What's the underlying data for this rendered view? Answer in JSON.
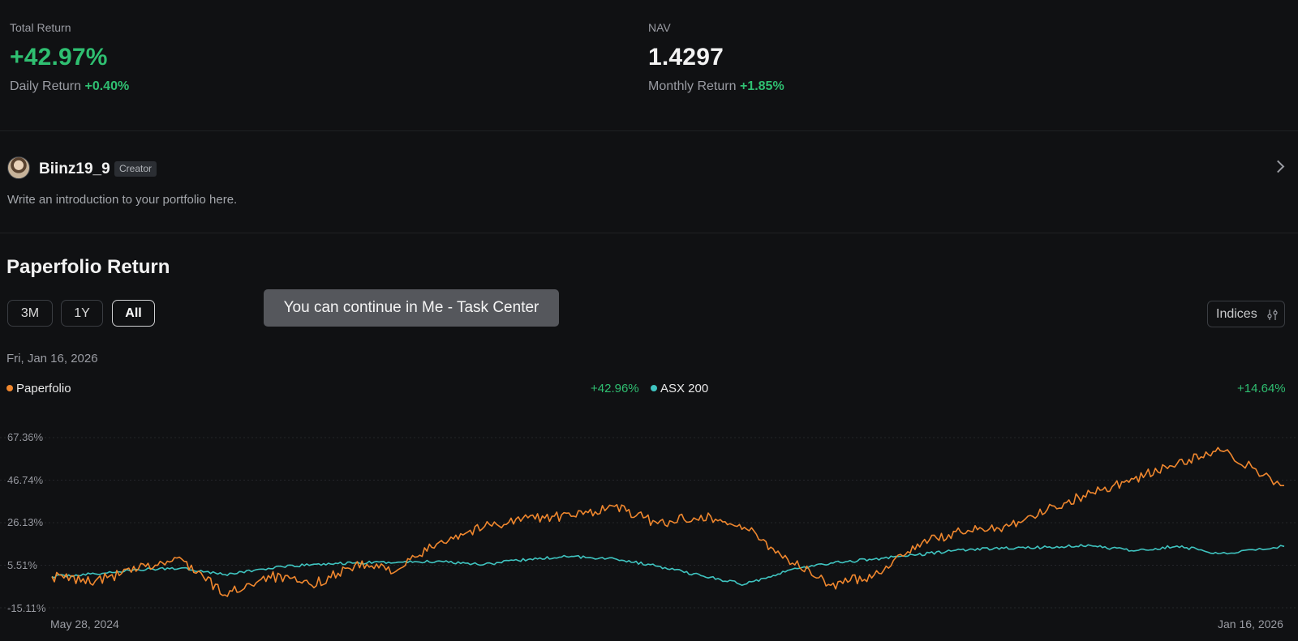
{
  "stats": {
    "total_return_label": "Total Return",
    "total_return_value": "+42.97%",
    "daily_return_label": "Daily Return",
    "daily_return_value": "+0.40%",
    "nav_label": "NAV",
    "nav_value": "1.4297",
    "monthly_return_label": "Monthly Return",
    "monthly_return_value": "+1.85%"
  },
  "creator": {
    "username": "Biinz19_9",
    "badge": "Creator",
    "intro": "Write an introduction to your portfolio here."
  },
  "section": {
    "title": "Paperfolio Return",
    "ranges": [
      "3M",
      "1Y",
      "All"
    ],
    "active_range": "All",
    "indices_label": "Indices",
    "toast": "You can continue in Me - Task Center",
    "date": "Fri, Jan 16, 2026"
  },
  "colors": {
    "paperfolio": "#f0872e",
    "asx": "#3fc4c0",
    "positive": "#2fbf71",
    "background": "#101113"
  },
  "chart_data": {
    "type": "line",
    "x_range": [
      "May 28, 2024",
      "Jan 16, 2026"
    ],
    "x_tick_labels": [
      "May 28, 2024",
      "Jan 16, 2026"
    ],
    "y_tick_labels": [
      "67.36%",
      "46.74%",
      "26.13%",
      "5.51%",
      "-15.11%"
    ],
    "ylim": [
      -15.11,
      67.36
    ],
    "grid": true,
    "legend": "top",
    "series": [
      {
        "name": "Paperfolio",
        "final_value_label": "+42.96%",
        "x": [
          "2024-05-28",
          "2024-06-18",
          "2024-07-09",
          "2024-07-30",
          "2024-08-20",
          "2024-09-10",
          "2024-10-01",
          "2024-10-22",
          "2024-11-12",
          "2024-12-03",
          "2024-12-24",
          "2025-01-14",
          "2025-02-04",
          "2025-02-25",
          "2025-03-18",
          "2025-04-08",
          "2025-04-29",
          "2025-05-20",
          "2025-06-10",
          "2025-07-01",
          "2025-07-22",
          "2025-08-12",
          "2025-09-02",
          "2025-09-23",
          "2025-10-14",
          "2025-11-04",
          "2025-11-25",
          "2025-12-16",
          "2026-01-16"
        ],
        "values": [
          0.0,
          -2.2,
          3.8,
          8.5,
          -8.9,
          0.5,
          -4.2,
          5.6,
          3.4,
          17.5,
          24.3,
          28.5,
          29.2,
          34.0,
          25.7,
          29.7,
          23.9,
          8.5,
          -4.2,
          0.8,
          15.8,
          21.6,
          24.3,
          32.4,
          40.6,
          47.3,
          54.7,
          61.0,
          44.1
        ]
      },
      {
        "name": "ASX 200",
        "final_value_label": "+14.64%",
        "x": [
          "2024-05-28",
          "2024-06-18",
          "2024-07-09",
          "2024-07-30",
          "2024-08-20",
          "2024-09-10",
          "2024-10-01",
          "2024-10-22",
          "2024-11-12",
          "2024-12-03",
          "2024-12-24",
          "2025-01-14",
          "2025-02-04",
          "2025-02-25",
          "2025-03-18",
          "2025-04-08",
          "2025-04-29",
          "2025-05-20",
          "2025-06-10",
          "2025-07-01",
          "2025-07-22",
          "2025-08-12",
          "2025-09-02",
          "2025-09-23",
          "2025-10-14",
          "2025-11-04",
          "2025-11-25",
          "2025-12-16",
          "2026-01-16"
        ],
        "values": [
          0.0,
          1.3,
          3.3,
          4.2,
          1.0,
          4.0,
          5.8,
          6.6,
          7.0,
          7.4,
          6.0,
          8.3,
          9.8,
          8.7,
          5.0,
          0.5,
          -3.8,
          3.0,
          6.6,
          8.5,
          10.6,
          13.0,
          13.7,
          14.2,
          15.1,
          12.4,
          14.8,
          11.2,
          14.6
        ]
      }
    ]
  }
}
